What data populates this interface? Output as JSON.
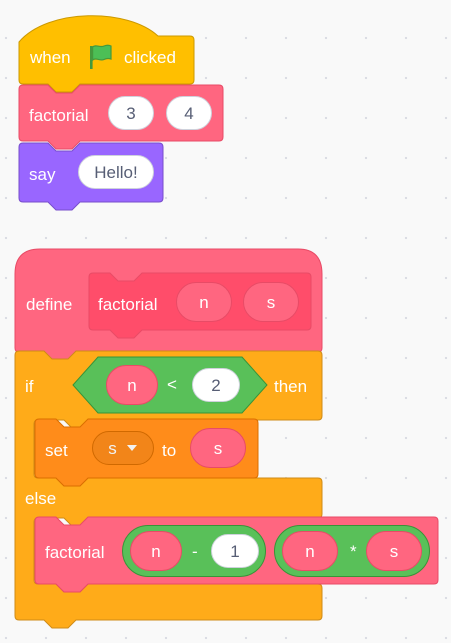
{
  "colors": {
    "events": "#ffbf00",
    "my_blocks": "#ff6680",
    "my_blocks_dark": "#ff4d6a",
    "looks": "#9966ff",
    "control": "#ffab19",
    "operators": "#59c059",
    "variables": "#ff8c1a",
    "canvas": "#f9f9f9"
  },
  "script1": {
    "hat": {
      "when": "when",
      "flag_icon": "green-flag-icon",
      "clicked": "clicked"
    },
    "call": {
      "name": "factorial",
      "arg1": "3",
      "arg2": "4"
    },
    "say": {
      "label": "say",
      "message": "Hello!"
    }
  },
  "script2": {
    "define": {
      "label": "define",
      "proc_name": "factorial",
      "param1": "n",
      "param2": "s"
    },
    "if_else": {
      "if_label": "if",
      "then_label": "then",
      "else_label": "else",
      "condition": {
        "left": "n",
        "op": "<",
        "right": "2"
      }
    },
    "set_block": {
      "label": "set",
      "variable": "s",
      "dropdown_icon": "caret-down-icon",
      "to_label": "to",
      "value": "s"
    },
    "recursive_call": {
      "name": "factorial",
      "arg1": {
        "left": "n",
        "op": "-",
        "right": "1"
      },
      "arg2": {
        "left": "n",
        "op": "*",
        "right": "s"
      }
    }
  }
}
